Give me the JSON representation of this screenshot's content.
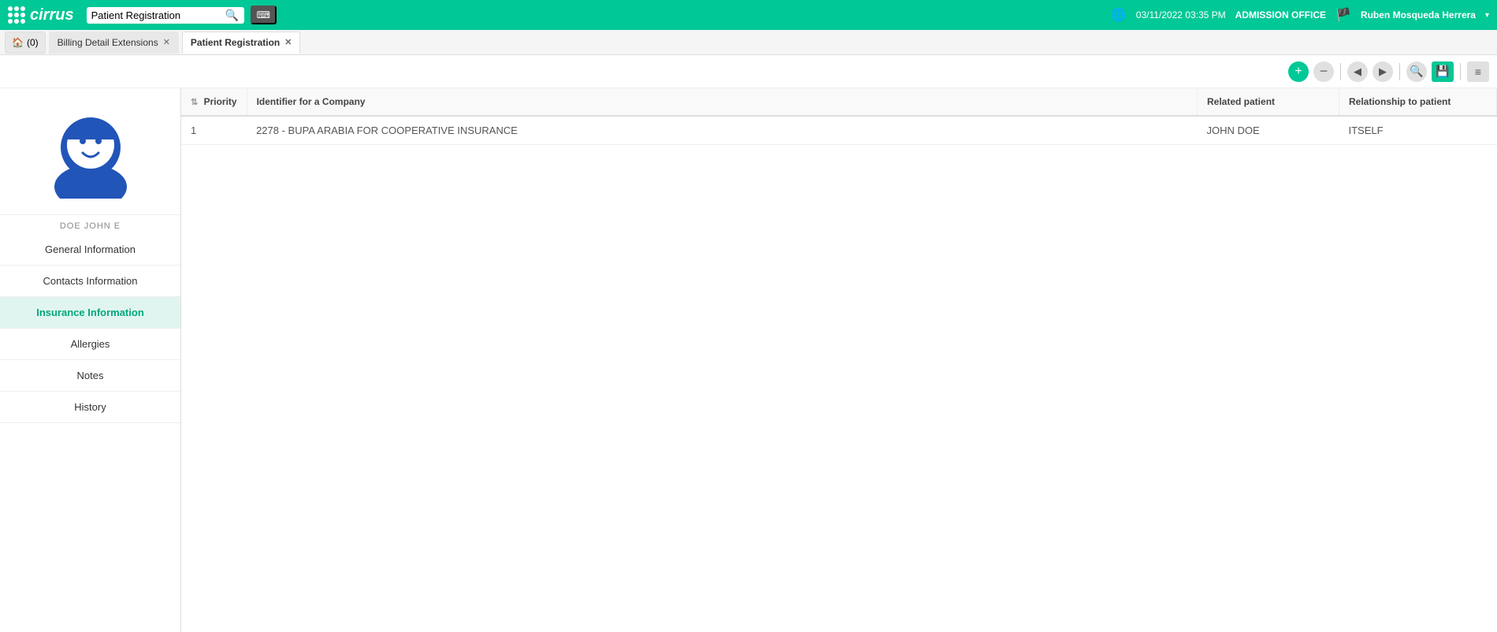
{
  "topbar": {
    "logo_text": "cirrus",
    "search_placeholder": "Patient Registration",
    "datetime": "03/11/2022 03:35 PM",
    "location": "ADMISSION OFFICE",
    "user": "Ruben Mosqueda Herrera",
    "dropdown_arrow": "▾"
  },
  "tabs": [
    {
      "id": "home",
      "label": "(0)",
      "closable": false,
      "active": false
    },
    {
      "id": "billing",
      "label": "Billing Detail Extensions",
      "closable": true,
      "active": false
    },
    {
      "id": "patient-reg",
      "label": "Patient Registration",
      "closable": true,
      "active": true
    }
  ],
  "toolbar": {
    "add_label": "+",
    "remove_label": "−",
    "search_label": "🔍",
    "save_label": "💾",
    "list_label": "≡"
  },
  "sidebar": {
    "patient_name": "DOE JOHN E",
    "nav_items": [
      {
        "id": "general",
        "label": "General Information",
        "active": false
      },
      {
        "id": "contacts",
        "label": "Contacts Information",
        "active": false
      },
      {
        "id": "insurance",
        "label": "Insurance Information",
        "active": true
      },
      {
        "id": "allergies",
        "label": "Allergies",
        "active": false
      },
      {
        "id": "notes",
        "label": "Notes",
        "active": false
      },
      {
        "id": "history",
        "label": "History",
        "active": false
      }
    ]
  },
  "table": {
    "columns": [
      {
        "id": "priority",
        "label": "Priority",
        "sortable": true
      },
      {
        "id": "identifier",
        "label": "Identifier for a Company",
        "sortable": false
      },
      {
        "id": "related",
        "label": "Related patient",
        "sortable": false
      },
      {
        "id": "relationship",
        "label": "Relationship to patient",
        "sortable": false
      }
    ],
    "rows": [
      {
        "priority": "1",
        "identifier": "2278 - BUPA ARABIA FOR COOPERATIVE INSURANCE",
        "related": "JOHN DOE",
        "relationship": "ITSELF"
      }
    ]
  }
}
